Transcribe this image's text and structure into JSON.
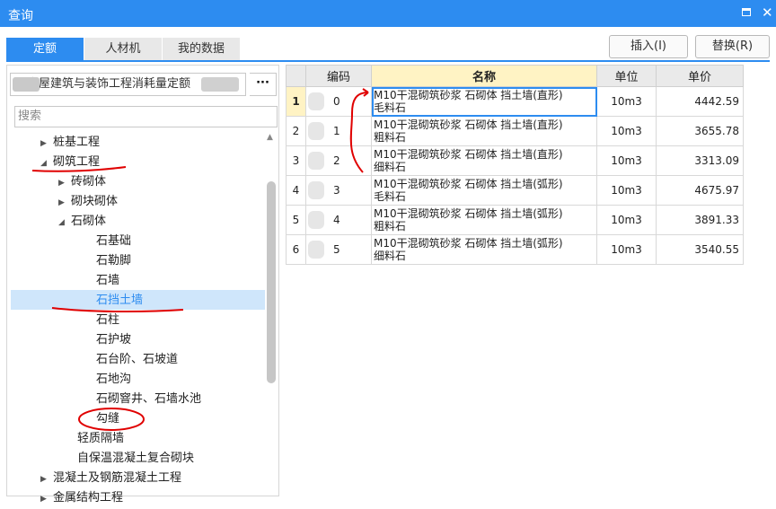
{
  "window": {
    "title": "查询"
  },
  "tabs": [
    {
      "label": "定额"
    },
    {
      "label": "人材机"
    },
    {
      "label": "我的数据"
    }
  ],
  "toolbar": {
    "insert_label": "插入(I)",
    "replace_label": "替换(R)"
  },
  "library": {
    "name": "房屋建筑与装饰工程消耗量定额",
    "more": "···"
  },
  "search": {
    "placeholder": "搜索"
  },
  "tree": [
    {
      "label": "桩基工程",
      "arrow": "▶"
    },
    {
      "label": "砌筑工程",
      "arrow": "◢"
    },
    {
      "label": "砖砌体",
      "arrow": "▶"
    },
    {
      "label": "砌块砌体",
      "arrow": "▶"
    },
    {
      "label": "石砌体",
      "arrow": "◢"
    },
    {
      "label": "石基础"
    },
    {
      "label": "石勒脚"
    },
    {
      "label": "石墙"
    },
    {
      "label": "石挡土墙"
    },
    {
      "label": "石柱"
    },
    {
      "label": "石护坡"
    },
    {
      "label": "石台阶、石坡道"
    },
    {
      "label": "石地沟"
    },
    {
      "label": "石砌窨井、石墙水池"
    },
    {
      "label": "勾缝"
    },
    {
      "label": "轻质隔墙"
    },
    {
      "label": "自保温混凝土复合砌块"
    },
    {
      "label": "混凝土及钢筋混凝土工程",
      "arrow": "▶"
    },
    {
      "label": "金属结构工程",
      "arrow": "▶"
    }
  ],
  "table": {
    "headers": {
      "code": "编码",
      "name": "名称",
      "unit": "单位",
      "price": "单价"
    },
    "rows": [
      {
        "idx": "1",
        "code": "0",
        "name1": "M10干混砌筑砂浆 石砌体 挡土墙(直形)",
        "name2": "毛料石",
        "unit": "10m3",
        "price": "4442.59"
      },
      {
        "idx": "2",
        "code": "1",
        "name1": "M10干混砌筑砂浆 石砌体 挡土墙(直形)",
        "name2": "粗料石",
        "unit": "10m3",
        "price": "3655.78"
      },
      {
        "idx": "3",
        "code": "2",
        "name1": "M10干混砌筑砂浆 石砌体 挡土墙(直形)",
        "name2": "细料石",
        "unit": "10m3",
        "price": "3313.09"
      },
      {
        "idx": "4",
        "code": "3",
        "name1": "M10干混砌筑砂浆 石砌体 挡土墙(弧形)",
        "name2": "毛料石",
        "unit": "10m3",
        "price": "4675.97"
      },
      {
        "idx": "5",
        "code": "4",
        "name1": "M10干混砌筑砂浆 石砌体 挡土墙(弧形)",
        "name2": "粗料石",
        "unit": "10m3",
        "price": "3891.33"
      },
      {
        "idx": "6",
        "code": "5",
        "name1": "M10干混砌筑砂浆 石砌体 挡土墙(弧形)",
        "name2": "细料石",
        "unit": "10m3",
        "price": "3540.55"
      }
    ]
  },
  "colors": {
    "accent": "#2d8cf0",
    "annotation": "#e00000",
    "selection": "#cfe6fb"
  }
}
